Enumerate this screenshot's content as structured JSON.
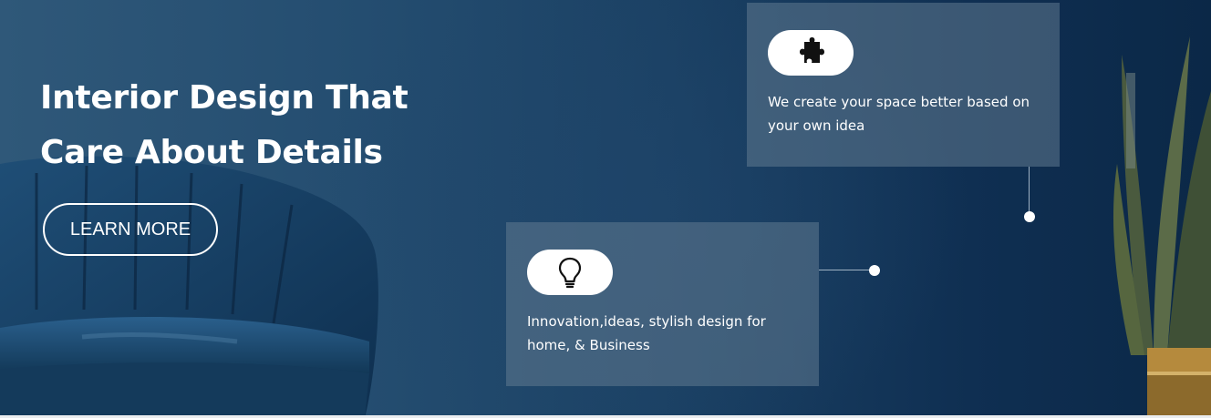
{
  "hero": {
    "headline_line1": "Interior Design That",
    "headline_line2": "Care About Details",
    "cta_label": "LEARN MORE"
  },
  "features": [
    {
      "icon": "puzzle-icon",
      "text": "We create your space better based on your own idea"
    },
    {
      "icon": "lightbulb-icon",
      "text": "Innovation,ideas, stylish design for home, & Business"
    }
  ],
  "colors": {
    "background": "#1b4164",
    "card": "#607a90",
    "text": "#ffffff"
  }
}
